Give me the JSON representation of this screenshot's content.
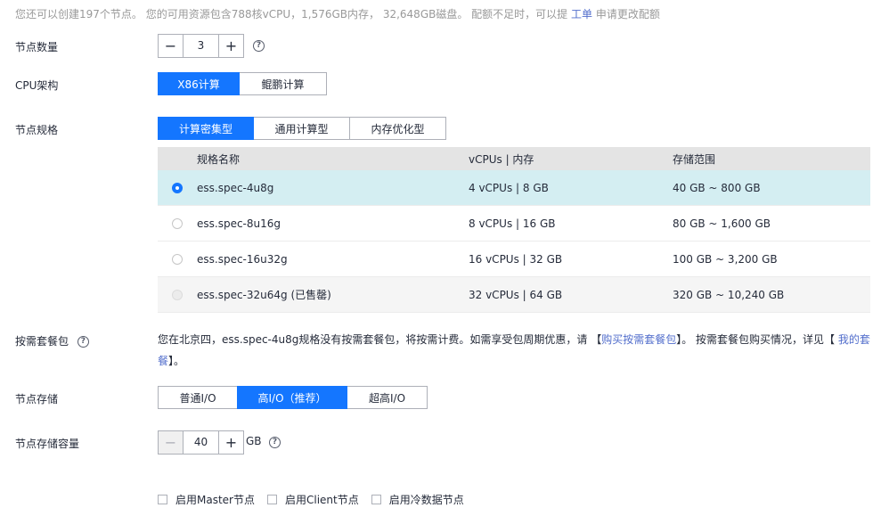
{
  "quota": {
    "text_before": "您还可以创建197个节点。 您的可用资源包含788核vCPU，1,576GB内存， 32,648GB磁盘。 配额不足时，可以提 ",
    "link": "工单",
    "text_after": " 申请更改配额"
  },
  "node_count": {
    "label": "节点数量",
    "minus": "−",
    "plus": "+",
    "value": "3",
    "help_icon": "question-circle-icon"
  },
  "cpu_arch": {
    "label": "CPU架构",
    "options": [
      "X86计算",
      "鲲鹏计算"
    ],
    "selected": 0
  },
  "node_spec": {
    "label": "节点规格",
    "tabs": [
      "计算密集型",
      "通用计算型",
      "内存优化型"
    ],
    "selected_tab": 0,
    "columns": [
      "规格名称",
      "vCPUs | 内存",
      "存储范围"
    ],
    "rows": [
      {
        "name": "ess.spec-4u8g",
        "cpu": "4 vCPUs | 8 GB",
        "storage": "40 GB ~ 800 GB",
        "state": "selected"
      },
      {
        "name": "ess.spec-8u16g",
        "cpu": "8 vCPUs | 16 GB",
        "storage": "80 GB ~ 1,600 GB",
        "state": "normal"
      },
      {
        "name": "ess.spec-16u32g",
        "cpu": "16 vCPUs | 32 GB",
        "storage": "100 GB ~ 3,200 GB",
        "state": "normal"
      },
      {
        "name": "ess.spec-32u64g (已售罄)",
        "cpu": "32 vCPUs | 64 GB",
        "storage": "320 GB ~ 10,240 GB",
        "state": "disabled"
      }
    ]
  },
  "package": {
    "label": "按需套餐包",
    "text1": "您在北京四，ess.spec-4u8g规格没有按需套餐包，将按需计费。如需享受包周期优惠，请 【",
    "link1": "购买按需套餐包",
    "text2": "】。 按需套餐包购买情况，详见【 ",
    "link2": "我的套餐",
    "text3": "】。"
  },
  "node_storage": {
    "label": "节点存储",
    "options": [
      "普通I/O",
      "高I/O（推荐）",
      "超高I/O"
    ],
    "selected": 1
  },
  "storage_capacity": {
    "label": "节点存储容量",
    "minus": "−",
    "plus": "+",
    "value": "40",
    "unit": "GB"
  },
  "checkboxes": [
    "启用Master节点",
    "启用Client节点",
    "启用冷数据节点"
  ]
}
